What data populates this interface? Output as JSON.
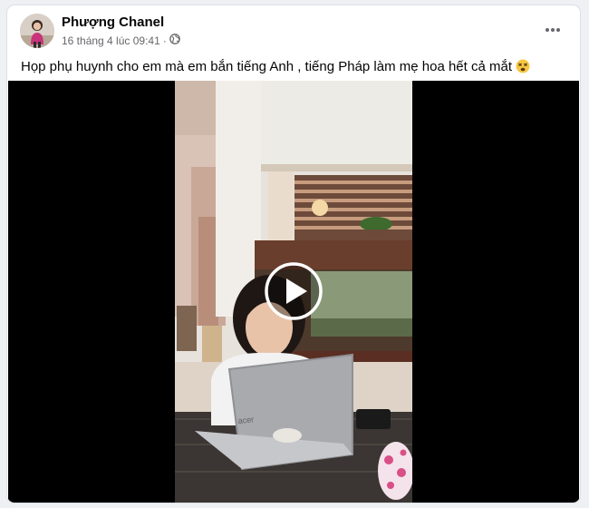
{
  "post": {
    "author": "Phượng Chanel",
    "timestamp": "16 tháng 4 lúc 09:41",
    "separator": "·",
    "audience_icon": "globe-icon",
    "more_icon": "more-dots-icon",
    "caption": "Họp phụ huynh cho em mà em bắn tiếng Anh , tiếng Pháp làm mẹ hoa hết cả mắt",
    "caption_emoji": "dizzy-face-emoji"
  },
  "video": {
    "play_icon": "play-icon",
    "laptop_logo": "acer"
  },
  "colors": {
    "author_text": "#050505",
    "meta_text": "#65676b",
    "video_background": "#000000"
  }
}
